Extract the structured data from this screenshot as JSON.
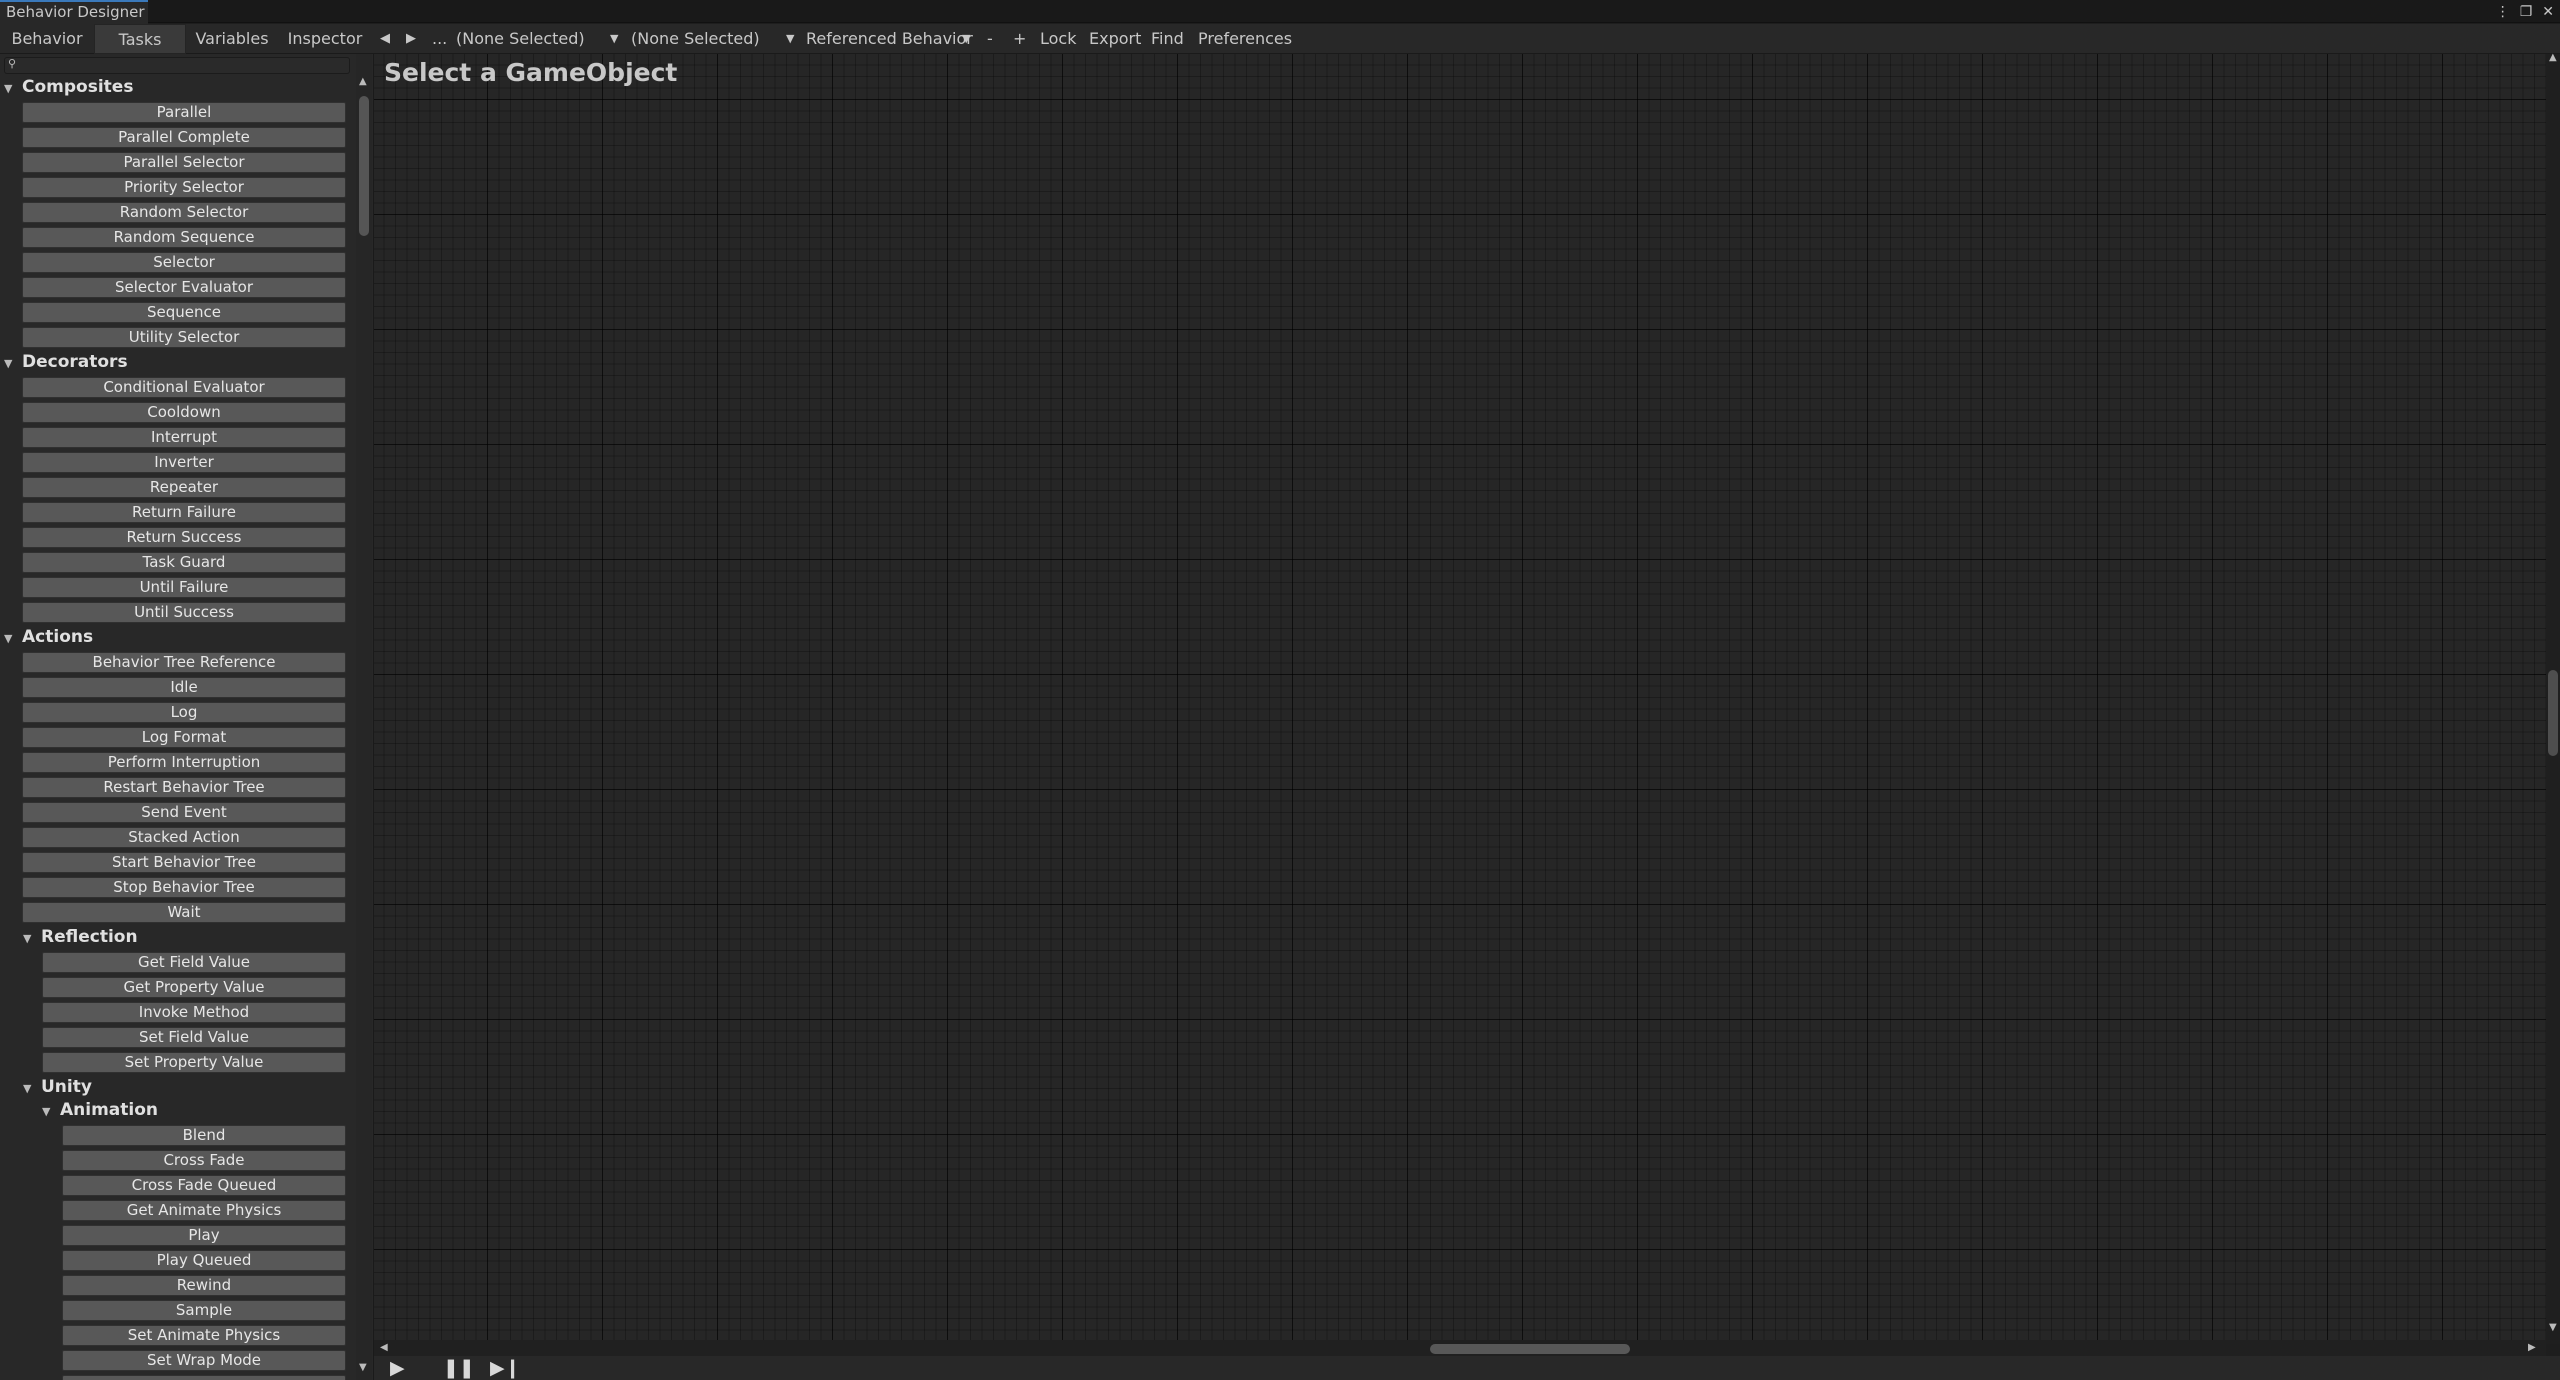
{
  "window": {
    "title": "Behavior Designer",
    "icons": [
      "kebab-menu-icon",
      "maximize-icon",
      "close-icon"
    ]
  },
  "panel_tabs": [
    {
      "label": "Behavior",
      "active": false
    },
    {
      "label": "Tasks",
      "active": true
    },
    {
      "label": "Variables",
      "active": false
    },
    {
      "label": "Inspector",
      "active": false
    }
  ],
  "toolbar": {
    "prev_icon": "triangle-left-icon",
    "next_icon": "triangle-right-icon",
    "more_label": "...",
    "gameobject_select": "(None Selected)",
    "behavior_select": "(None Selected)",
    "referenced_behavior": "Referenced Behavior",
    "minus_label": "-",
    "plus_label": "+",
    "lock_label": "Lock",
    "export_label": "Export",
    "find_label": "Find",
    "preferences_label": "Preferences"
  },
  "search": {
    "value": "",
    "icon": "search-icon"
  },
  "categories": {
    "composites": {
      "name": "Composites",
      "tasks": [
        "Parallel",
        "Parallel Complete",
        "Parallel Selector",
        "Priority Selector",
        "Random Selector",
        "Random Sequence",
        "Selector",
        "Selector Evaluator",
        "Sequence",
        "Utility Selector"
      ]
    },
    "decorators": {
      "name": "Decorators",
      "tasks": [
        "Conditional Evaluator",
        "Cooldown",
        "Interrupt",
        "Inverter",
        "Repeater",
        "Return Failure",
        "Return Success",
        "Task Guard",
        "Until Failure",
        "Until Success"
      ]
    },
    "actions": {
      "name": "Actions",
      "tasks": [
        "Behavior Tree Reference",
        "Idle",
        "Log",
        "Log Format",
        "Perform Interruption",
        "Restart Behavior Tree",
        "Send Event",
        "Stacked Action",
        "Start Behavior Tree",
        "Stop Behavior Tree",
        "Wait"
      ]
    },
    "reflection": {
      "name": "Reflection",
      "tasks": [
        "Get Field Value",
        "Get Property Value",
        "Invoke Method",
        "Set Field Value",
        "Set Property Value"
      ]
    },
    "unity": {
      "name": "Unity"
    },
    "animation": {
      "name": "Animation",
      "tasks": [
        "Blend",
        "Cross Fade",
        "Cross Fade Queued",
        "Get Animate Physics",
        "Play",
        "Play Queued",
        "Rewind",
        "Sample",
        "Set Animate Physics",
        "Set Wrap Mode"
      ]
    }
  },
  "canvas": {
    "title": "Select a GameObject"
  },
  "playback": {
    "play_icon": "play-icon",
    "pause_icon": "pause-icon",
    "step_icon": "step-icon"
  }
}
